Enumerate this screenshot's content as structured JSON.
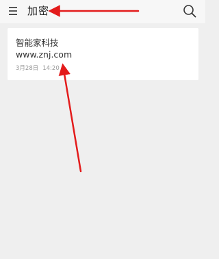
{
  "header": {
    "title": "加密",
    "menu_icon": "hamburger-menu-icon",
    "search_icon": "search-icon"
  },
  "notes": [
    {
      "line1": "智能家科技",
      "line2": "www.znj.com",
      "date": "3月28日",
      "time": "14:20"
    }
  ],
  "colors": {
    "background": "#efefef",
    "app_bar": "#f7f7f7",
    "card": "#ffffff",
    "annotation_arrow": "#e31b1b"
  }
}
